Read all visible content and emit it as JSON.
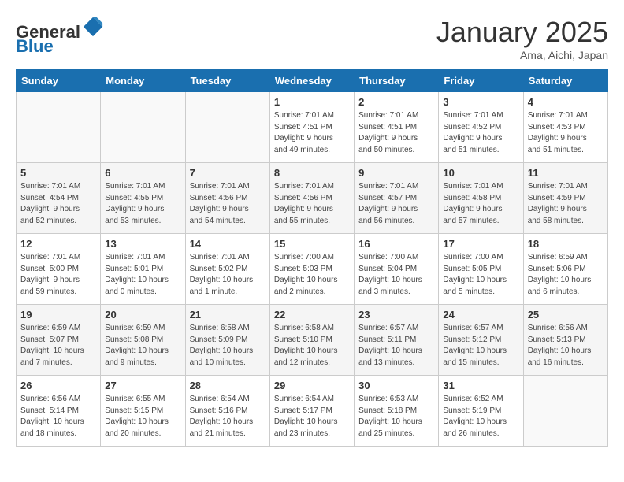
{
  "header": {
    "logo_general": "General",
    "logo_blue": "Blue",
    "month_title": "January 2025",
    "subtitle": "Ama, Aichi, Japan"
  },
  "days_of_week": [
    "Sunday",
    "Monday",
    "Tuesday",
    "Wednesday",
    "Thursday",
    "Friday",
    "Saturday"
  ],
  "weeks": [
    [
      {
        "day": "",
        "info": ""
      },
      {
        "day": "",
        "info": ""
      },
      {
        "day": "",
        "info": ""
      },
      {
        "day": "1",
        "info": "Sunrise: 7:01 AM\nSunset: 4:51 PM\nDaylight: 9 hours\nand 49 minutes."
      },
      {
        "day": "2",
        "info": "Sunrise: 7:01 AM\nSunset: 4:51 PM\nDaylight: 9 hours\nand 50 minutes."
      },
      {
        "day": "3",
        "info": "Sunrise: 7:01 AM\nSunset: 4:52 PM\nDaylight: 9 hours\nand 51 minutes."
      },
      {
        "day": "4",
        "info": "Sunrise: 7:01 AM\nSunset: 4:53 PM\nDaylight: 9 hours\nand 51 minutes."
      }
    ],
    [
      {
        "day": "5",
        "info": "Sunrise: 7:01 AM\nSunset: 4:54 PM\nDaylight: 9 hours\nand 52 minutes."
      },
      {
        "day": "6",
        "info": "Sunrise: 7:01 AM\nSunset: 4:55 PM\nDaylight: 9 hours\nand 53 minutes."
      },
      {
        "day": "7",
        "info": "Sunrise: 7:01 AM\nSunset: 4:56 PM\nDaylight: 9 hours\nand 54 minutes."
      },
      {
        "day": "8",
        "info": "Sunrise: 7:01 AM\nSunset: 4:56 PM\nDaylight: 9 hours\nand 55 minutes."
      },
      {
        "day": "9",
        "info": "Sunrise: 7:01 AM\nSunset: 4:57 PM\nDaylight: 9 hours\nand 56 minutes."
      },
      {
        "day": "10",
        "info": "Sunrise: 7:01 AM\nSunset: 4:58 PM\nDaylight: 9 hours\nand 57 minutes."
      },
      {
        "day": "11",
        "info": "Sunrise: 7:01 AM\nSunset: 4:59 PM\nDaylight: 9 hours\nand 58 minutes."
      }
    ],
    [
      {
        "day": "12",
        "info": "Sunrise: 7:01 AM\nSunset: 5:00 PM\nDaylight: 9 hours\nand 59 minutes."
      },
      {
        "day": "13",
        "info": "Sunrise: 7:01 AM\nSunset: 5:01 PM\nDaylight: 10 hours\nand 0 minutes."
      },
      {
        "day": "14",
        "info": "Sunrise: 7:01 AM\nSunset: 5:02 PM\nDaylight: 10 hours\nand 1 minute."
      },
      {
        "day": "15",
        "info": "Sunrise: 7:00 AM\nSunset: 5:03 PM\nDaylight: 10 hours\nand 2 minutes."
      },
      {
        "day": "16",
        "info": "Sunrise: 7:00 AM\nSunset: 5:04 PM\nDaylight: 10 hours\nand 3 minutes."
      },
      {
        "day": "17",
        "info": "Sunrise: 7:00 AM\nSunset: 5:05 PM\nDaylight: 10 hours\nand 5 minutes."
      },
      {
        "day": "18",
        "info": "Sunrise: 6:59 AM\nSunset: 5:06 PM\nDaylight: 10 hours\nand 6 minutes."
      }
    ],
    [
      {
        "day": "19",
        "info": "Sunrise: 6:59 AM\nSunset: 5:07 PM\nDaylight: 10 hours\nand 7 minutes."
      },
      {
        "day": "20",
        "info": "Sunrise: 6:59 AM\nSunset: 5:08 PM\nDaylight: 10 hours\nand 9 minutes."
      },
      {
        "day": "21",
        "info": "Sunrise: 6:58 AM\nSunset: 5:09 PM\nDaylight: 10 hours\nand 10 minutes."
      },
      {
        "day": "22",
        "info": "Sunrise: 6:58 AM\nSunset: 5:10 PM\nDaylight: 10 hours\nand 12 minutes."
      },
      {
        "day": "23",
        "info": "Sunrise: 6:57 AM\nSunset: 5:11 PM\nDaylight: 10 hours\nand 13 minutes."
      },
      {
        "day": "24",
        "info": "Sunrise: 6:57 AM\nSunset: 5:12 PM\nDaylight: 10 hours\nand 15 minutes."
      },
      {
        "day": "25",
        "info": "Sunrise: 6:56 AM\nSunset: 5:13 PM\nDaylight: 10 hours\nand 16 minutes."
      }
    ],
    [
      {
        "day": "26",
        "info": "Sunrise: 6:56 AM\nSunset: 5:14 PM\nDaylight: 10 hours\nand 18 minutes."
      },
      {
        "day": "27",
        "info": "Sunrise: 6:55 AM\nSunset: 5:15 PM\nDaylight: 10 hours\nand 20 minutes."
      },
      {
        "day": "28",
        "info": "Sunrise: 6:54 AM\nSunset: 5:16 PM\nDaylight: 10 hours\nand 21 minutes."
      },
      {
        "day": "29",
        "info": "Sunrise: 6:54 AM\nSunset: 5:17 PM\nDaylight: 10 hours\nand 23 minutes."
      },
      {
        "day": "30",
        "info": "Sunrise: 6:53 AM\nSunset: 5:18 PM\nDaylight: 10 hours\nand 25 minutes."
      },
      {
        "day": "31",
        "info": "Sunrise: 6:52 AM\nSunset: 5:19 PM\nDaylight: 10 hours\nand 26 minutes."
      },
      {
        "day": "",
        "info": ""
      }
    ]
  ]
}
